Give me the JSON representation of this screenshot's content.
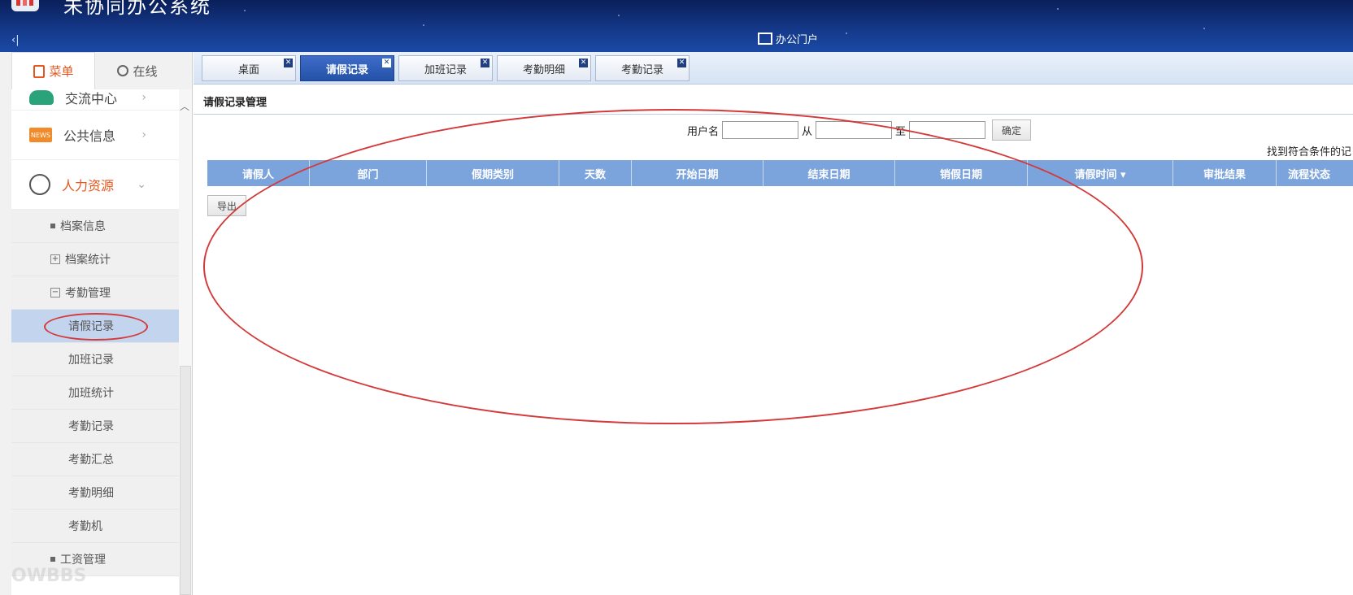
{
  "header": {
    "app_title": "未协同办公系统",
    "collapse_label": "‹|",
    "portal_label": "办公门户"
  },
  "sidebar": {
    "tabs": [
      {
        "label": "菜单"
      },
      {
        "label": "在线"
      }
    ],
    "menu": {
      "partial_item": "交流中心",
      "public_info": "公共信息",
      "hr": "人力资源",
      "news_badge": "NEWS",
      "sub_items": {
        "archive_info": "档案信息",
        "archive_stats": "档案统计",
        "attendance_mgmt": "考勤管理",
        "salary_mgmt": "工资管理"
      },
      "leaves": [
        "请假记录",
        "加班记录",
        "加班统计",
        "考勤记录",
        "考勤汇总",
        "考勤明细",
        "考勤机"
      ]
    },
    "watermark": "OWBBS"
  },
  "tabs": [
    {
      "label": "桌面"
    },
    {
      "label": "请假记录"
    },
    {
      "label": "加班记录"
    },
    {
      "label": "考勤明细"
    },
    {
      "label": "考勤记录"
    }
  ],
  "content": {
    "title": "请假记录管理",
    "search": {
      "username_label": "用户名",
      "from_label": "从",
      "to_label": "至",
      "confirm_label": "确定"
    },
    "found_text": "找到符合条件的记",
    "columns": [
      "请假人",
      "部门",
      "假期类别",
      "天数",
      "开始日期",
      "结束日期",
      "销假日期",
      "请假时间 ▾",
      "审批结果",
      "流程状态"
    ],
    "export_label": "导出"
  }
}
